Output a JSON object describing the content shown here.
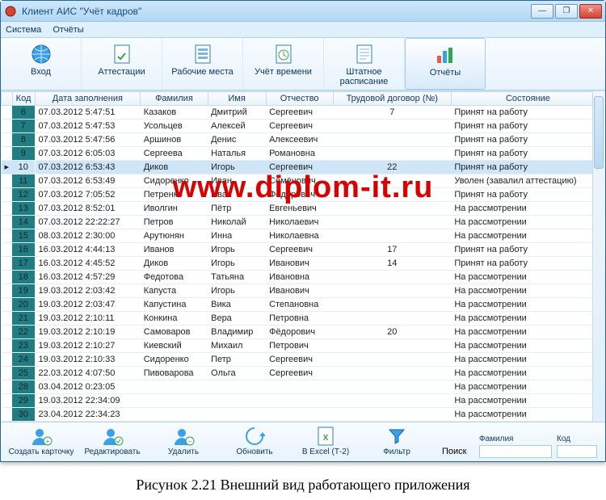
{
  "window": {
    "title": "Клиент АИС \"Учёт кадров\""
  },
  "menubar": {
    "items": [
      "Система",
      "Отчёты"
    ]
  },
  "toolbar": {
    "items": [
      {
        "label": "Вход",
        "icon": "globe"
      },
      {
        "label": "Аттестации",
        "icon": "doc-check"
      },
      {
        "label": "Рабочие места",
        "icon": "doc-grid"
      },
      {
        "label": "Учёт времени",
        "icon": "doc-time"
      },
      {
        "label": "Штатное расписание",
        "icon": "doc-lines"
      },
      {
        "label": "Отчёты",
        "icon": "chart"
      }
    ],
    "selected_index": 5
  },
  "grid": {
    "columns": [
      "Код",
      "Дата заполнения",
      "Фамилия",
      "Имя",
      "Отчество",
      "Трудовой договор (№)",
      "Состояние"
    ],
    "selected_row_index": 4,
    "rows": [
      {
        "num": 6,
        "date": "07.03.2012 5:47:51",
        "fam": "Казаков",
        "name": "Дмитрий",
        "otch": "Сергеевич",
        "contract": "7",
        "state": "Принят на работу"
      },
      {
        "num": 7,
        "date": "07.03.2012 5:47:53",
        "fam": "Усольцев",
        "name": "Алексей",
        "otch": "Сергеевич",
        "contract": "",
        "state": "Принят на работу"
      },
      {
        "num": 8,
        "date": "07.03.2012 5:47:56",
        "fam": "Аршинов",
        "name": "Денис",
        "otch": "Алексеевич",
        "contract": "",
        "state": "Принят на работу"
      },
      {
        "num": 9,
        "date": "07.03.2012 6:05:03",
        "fam": "Сергеева",
        "name": "Наталья",
        "otch": "Романовна",
        "contract": "",
        "state": "Принят на работу"
      },
      {
        "num": 10,
        "date": "07.03.2012 6:53:43",
        "fam": "Диков",
        "name": "Игорь",
        "otch": "Сергеевич",
        "contract": "22",
        "state": "Принят на работу"
      },
      {
        "num": 11,
        "date": "07.03.2012 6:53:49",
        "fam": "Сидоренко",
        "name": "Иван",
        "otch": "Семёнович",
        "contract": "",
        "state": "Уволен (завалил аттестацию)"
      },
      {
        "num": 12,
        "date": "07.03.2012 7:05:52",
        "fam": "Петренко",
        "name": "Иван",
        "otch": "Фёдорович",
        "contract": "",
        "state": "Принят на работу"
      },
      {
        "num": 13,
        "date": "07.03.2012 8:52:01",
        "fam": "Иволгин",
        "name": "Пётр",
        "otch": "Евгеньевич",
        "contract": "",
        "state": "На рассмотрении"
      },
      {
        "num": 14,
        "date": "07.03.2012 22:22:27",
        "fam": "Петров",
        "name": "Николай",
        "otch": "Николаевич",
        "contract": "",
        "state": "На рассмотрении"
      },
      {
        "num": 15,
        "date": "08.03.2012 2:30:00",
        "fam": "Арутюнян",
        "name": "Инна",
        "otch": "Николаевна",
        "contract": "",
        "state": "На рассмотрении"
      },
      {
        "num": 16,
        "date": "16.03.2012 4:44:13",
        "fam": "Иванов",
        "name": "Игорь",
        "otch": "Сергеевич",
        "contract": "17",
        "state": "Принят на работу"
      },
      {
        "num": 17,
        "date": "16.03.2012 4:45:52",
        "fam": "Диков",
        "name": "Игорь",
        "otch": "Иванович",
        "contract": "14",
        "state": "Принят на работу"
      },
      {
        "num": 18,
        "date": "16.03.2012 4:57:29",
        "fam": "Федотова",
        "name": "Татьяна",
        "otch": "Ивановна",
        "contract": "",
        "state": "На рассмотрении"
      },
      {
        "num": 19,
        "date": "19.03.2012 2:03:42",
        "fam": "Капуста",
        "name": "Игорь",
        "otch": "Иванович",
        "contract": "",
        "state": "На рассмотрении"
      },
      {
        "num": 20,
        "date": "19.03.2012 2:03:47",
        "fam": "Капустина",
        "name": "Вика",
        "otch": "Степановна",
        "contract": "",
        "state": "На рассмотрении"
      },
      {
        "num": 21,
        "date": "19.03.2012 2:10:11",
        "fam": "Конкина",
        "name": "Вера",
        "otch": "Петровна",
        "contract": "",
        "state": "На рассмотрении"
      },
      {
        "num": 22,
        "date": "19.03.2012 2:10:19",
        "fam": "Самоваров",
        "name": "Владимир",
        "otch": "Фёдорович",
        "contract": "20",
        "state": "На рассмотрении"
      },
      {
        "num": 23,
        "date": "19.03.2012 2:10:27",
        "fam": "Киевский",
        "name": "Михаил",
        "otch": "Петрович",
        "contract": "",
        "state": "На рассмотрении"
      },
      {
        "num": 24,
        "date": "19.03.2012 2:10:33",
        "fam": "Сидоренко",
        "name": "Петр",
        "otch": "Сергеевич",
        "contract": "",
        "state": "На рассмотрении"
      },
      {
        "num": 25,
        "date": "22.03.2012 4:07:50",
        "fam": "Пивоварова",
        "name": "Ольга",
        "otch": "Сергеевич",
        "contract": "",
        "state": "На рассмотрении"
      },
      {
        "num": 28,
        "date": "03.04.2012 0:23:05",
        "fam": "",
        "name": "",
        "otch": "",
        "contract": "",
        "state": "На рассмотрении"
      },
      {
        "num": 29,
        "date": "19.03.2012 22:34:09",
        "fam": "",
        "name": "",
        "otch": "",
        "contract": "",
        "state": "На рассмотрении"
      },
      {
        "num": 30,
        "date": "23.04.2012 22:34:23",
        "fam": "",
        "name": "",
        "otch": "",
        "contract": "",
        "state": "На рассмотрении"
      }
    ]
  },
  "bottombar": {
    "buttons": [
      {
        "label": "Создать карточку"
      },
      {
        "label": "Редактировать"
      },
      {
        "label": "Удалить"
      },
      {
        "label": "Обновить"
      },
      {
        "label": "В Excel (Т-2)"
      },
      {
        "label": "Фильтр"
      }
    ],
    "search": {
      "label": "Поиск",
      "famLabel": "Фамилия",
      "codeLabel": "Код"
    }
  },
  "watermark": "www.diplom-it.ru",
  "caption": "Рисунок 2.21 Внешний вид работающего приложения"
}
